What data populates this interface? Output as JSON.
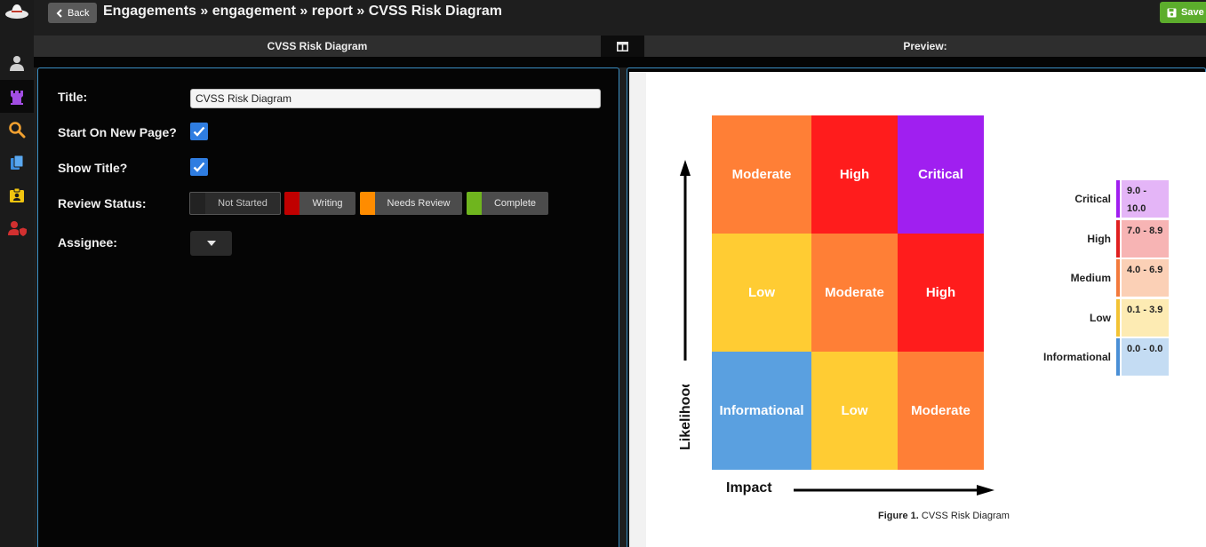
{
  "header": {
    "back_label": "Back",
    "breadcrumb": "Engagements » engagement » report » CVSS Risk Diagram",
    "save_label": "Save"
  },
  "sidebar": {
    "items": [
      {
        "icon": "user-icon",
        "color": "#cfcfcf"
      },
      {
        "icon": "castle-icon",
        "color": "#a24ee3"
      },
      {
        "icon": "search-icon",
        "color": "#f0a030"
      },
      {
        "icon": "documents-icon",
        "color": "#3d8fe0"
      },
      {
        "icon": "clipboard-user-icon",
        "color": "#f1c40f"
      },
      {
        "icon": "user-shield-icon",
        "color": "#d23030"
      }
    ]
  },
  "panels": {
    "editor_title": "CVSS Risk Diagram",
    "preview_title": "Preview:"
  },
  "form": {
    "title_label": "Title:",
    "title_value": "CVSS Risk Diagram",
    "new_page_label": "Start On New Page?",
    "new_page_checked": true,
    "show_title_label": "Show Title?",
    "show_title_checked": true,
    "review_status_label": "Review Status:",
    "review_status_options": [
      {
        "label": "Not Started",
        "color": "#222222",
        "selected": true
      },
      {
        "label": "Writing",
        "color": "#c00000"
      },
      {
        "label": "Needs Review",
        "color": "#ff8c00"
      },
      {
        "label": "Complete",
        "color": "#6fb51e"
      }
    ],
    "assignee_label": "Assignee:"
  },
  "diagram": {
    "grid": [
      [
        "Moderate",
        "High",
        "Critical"
      ],
      [
        "Low",
        "Moderate",
        "High"
      ],
      [
        "Informational",
        "Low",
        "Moderate"
      ]
    ],
    "colors": {
      "Critical": "#a01ff0",
      "High": "#ff1c1c",
      "Moderate": "#ff7f36",
      "Low": "#ffcc33",
      "Informational": "#5aa0e0"
    },
    "y_axis_label": "Likelihood",
    "x_axis_label": "Impact",
    "caption_prefix": "Figure 1.",
    "caption_text": "CVSS Risk Diagram",
    "legend": [
      {
        "name": "Critical",
        "range": "9.0 - 10.0",
        "bar": "#a01ff0",
        "bg": "#e4b5f7"
      },
      {
        "name": "High",
        "range": "7.0 - 8.9",
        "bar": "#e02020",
        "bg": "#f7b4b4"
      },
      {
        "name": "Medium",
        "range": "4.0 - 6.9",
        "bar": "#f37a3c",
        "bg": "#fbd0b6"
      },
      {
        "name": "Low",
        "range": "0.1 - 3.9",
        "bar": "#f3c334",
        "bg": "#fdebb3"
      },
      {
        "name": "Informational",
        "range": "0.0 - 0.0",
        "bar": "#4a8fd6",
        "bg": "#c4dcf3"
      }
    ]
  }
}
